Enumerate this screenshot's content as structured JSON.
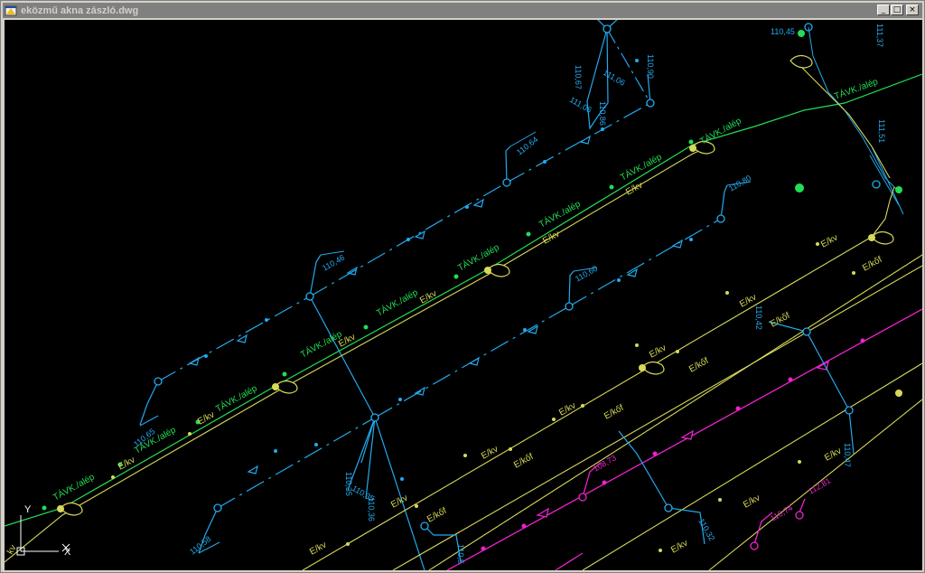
{
  "window": {
    "title": "eközmű akna zászló.dwg",
    "buttons": {
      "minimize": "_",
      "maximize": "□",
      "close": "×"
    }
  },
  "colors": {
    "canvas": "#000000",
    "blue": "#22aaee",
    "green": "#22dd55",
    "yellow": "#d8d85a",
    "magenta": "#ee22cc",
    "ucs": "#ffffff"
  },
  "icons": {
    "app": "autocad-drawing-icon",
    "ucs": "ucs-axis-icon"
  },
  "ucs": {
    "y": "Y",
    "x": "X"
  },
  "labels": {
    "tavk": "TÁVK./alép",
    "ekv": "E/kv",
    "ek8f": "E/kőf",
    "kv_edge": "kv"
  },
  "elevations": {
    "e11064": "110,64",
    "e11046": "110,46",
    "e11065": "110,65",
    "e11058": "110,58",
    "e11060": "110,60",
    "e11080": "110,80",
    "e11035": "110,35",
    "e11035b": "110,35",
    "e11036": "110,36",
    "e11067": "110,67",
    "e11106": "111,06",
    "e11109": "111,06",
    "e11086": "110,86",
    "e11090": "110,90",
    "e11045": "110,45",
    "e11137": "111,37",
    "e11151": "111,51",
    "e10873": "108,73",
    "e11074": "110,74",
    "e11281": "112,81",
    "e11047": "110,47",
    "e11042": "110,42",
    "e11032": "110,32",
    "e11055": "110,5"
  }
}
